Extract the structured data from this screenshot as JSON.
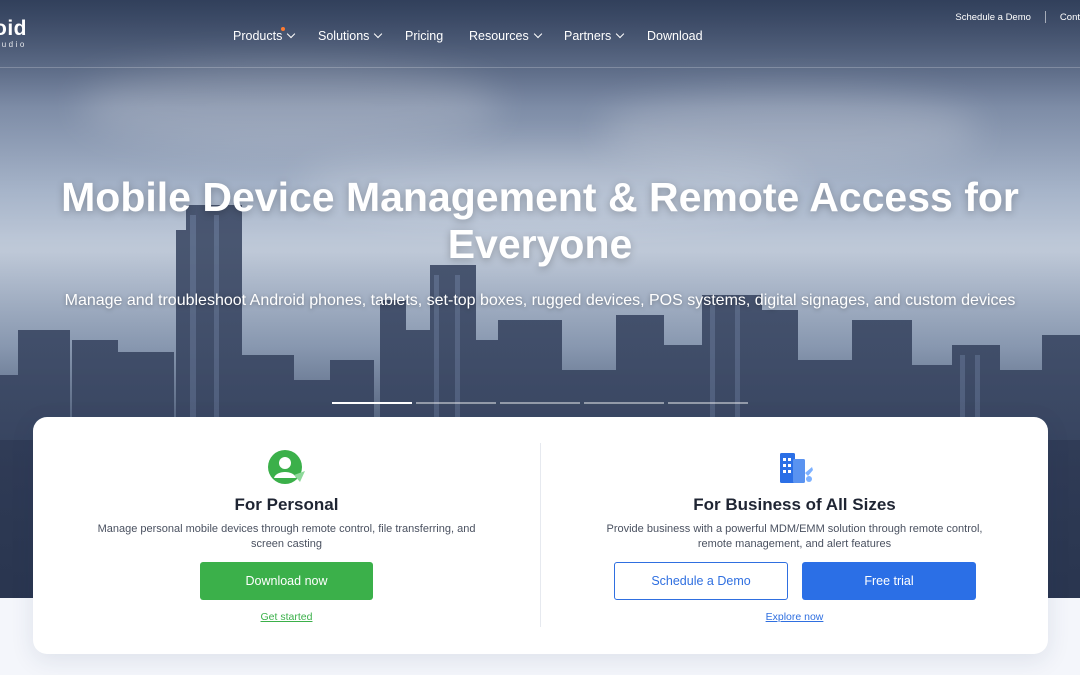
{
  "brand": {
    "logo_main": "oid",
    "logo_sub": "tudio"
  },
  "nav": {
    "items": [
      {
        "label": "Products",
        "has_dropdown": true
      },
      {
        "label": "Solutions",
        "has_dropdown": true
      },
      {
        "label": "Pricing",
        "has_dropdown": false
      },
      {
        "label": "Resources",
        "has_dropdown": true
      },
      {
        "label": "Partners",
        "has_dropdown": true
      },
      {
        "label": "Download",
        "has_dropdown": false
      }
    ],
    "schedule_demo": "Schedule a Demo",
    "contact_partial": "Cont"
  },
  "hero": {
    "headline": "Mobile Device Management & Remote Access for Everyone",
    "subline": "Manage and troubleshoot Android phones, tablets, set-top boxes, rugged devices, POS systems, digital signages, and custom devices",
    "slide_count": 5,
    "active_slide": 1
  },
  "personal": {
    "icon": "person-icon",
    "title": "For Personal",
    "description": "Manage personal mobile devices through remote control, file transferring, and screen casting",
    "cta": "Download now",
    "link": "Get started"
  },
  "business": {
    "icon": "business-building-icon",
    "title": "For Business of All Sizes",
    "description": "Provide business with a powerful MDM/EMM solution through remote control, remote management, and alert features",
    "cta_secondary": "Schedule a Demo",
    "cta_primary": "Free trial",
    "link": "Explore now"
  },
  "colors": {
    "accent_green": "#3bb04a",
    "accent_blue": "#2b6fe6",
    "nav_dot": "#ff7a2f"
  }
}
